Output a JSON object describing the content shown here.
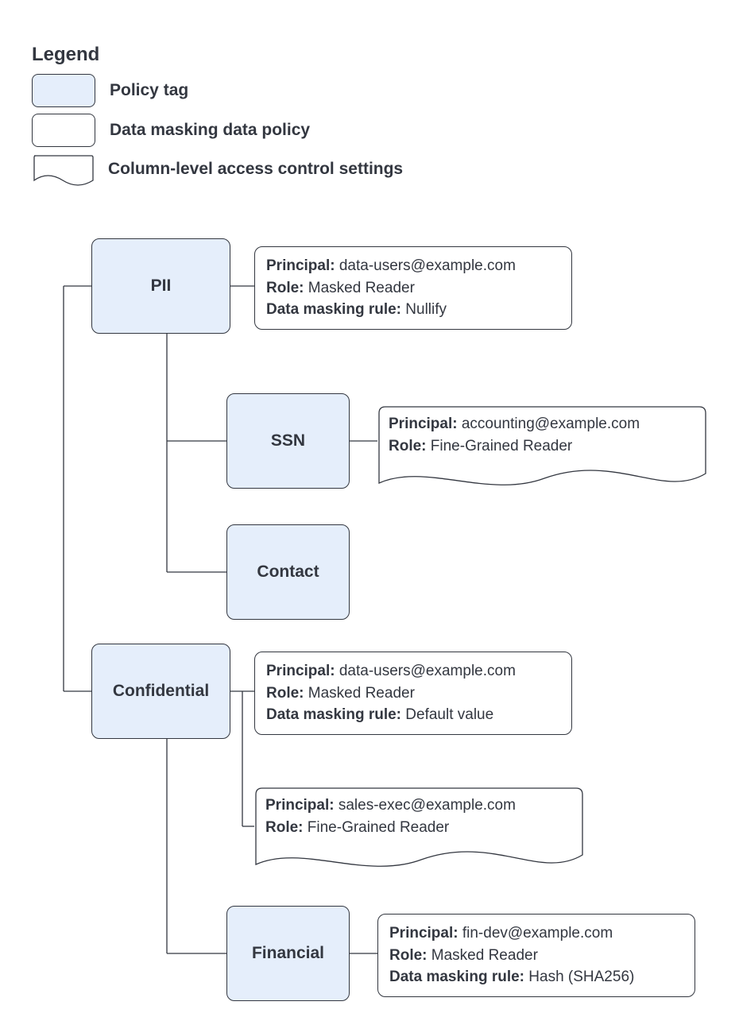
{
  "legend": {
    "title": "Legend",
    "tag_label": "Policy tag",
    "policy_label": "Data masking data policy",
    "clacs_label": "Column-level access control settings"
  },
  "labels": {
    "principal": "Principal:",
    "role": "Role:",
    "rule": "Data masking rule:"
  },
  "tags": {
    "pii": "PII",
    "ssn": "SSN",
    "contact": "Contact",
    "confidential": "Confidential",
    "financial": "Financial"
  },
  "pii_policy": {
    "principal": "data-users@example.com",
    "role": "Masked Reader",
    "rule": "Nullify"
  },
  "ssn_clacs": {
    "principal": "accounting@example.com",
    "role": "Fine-Grained Reader"
  },
  "conf_policy": {
    "principal": "data-users@example.com",
    "role": "Masked Reader",
    "rule": "Default value"
  },
  "conf_clacs": {
    "principal": "sales-exec@example.com",
    "role": "Fine-Grained Reader"
  },
  "fin_policy": {
    "principal": "fin-dev@example.com",
    "role": "Masked Reader",
    "rule": "Hash (SHA256)"
  }
}
